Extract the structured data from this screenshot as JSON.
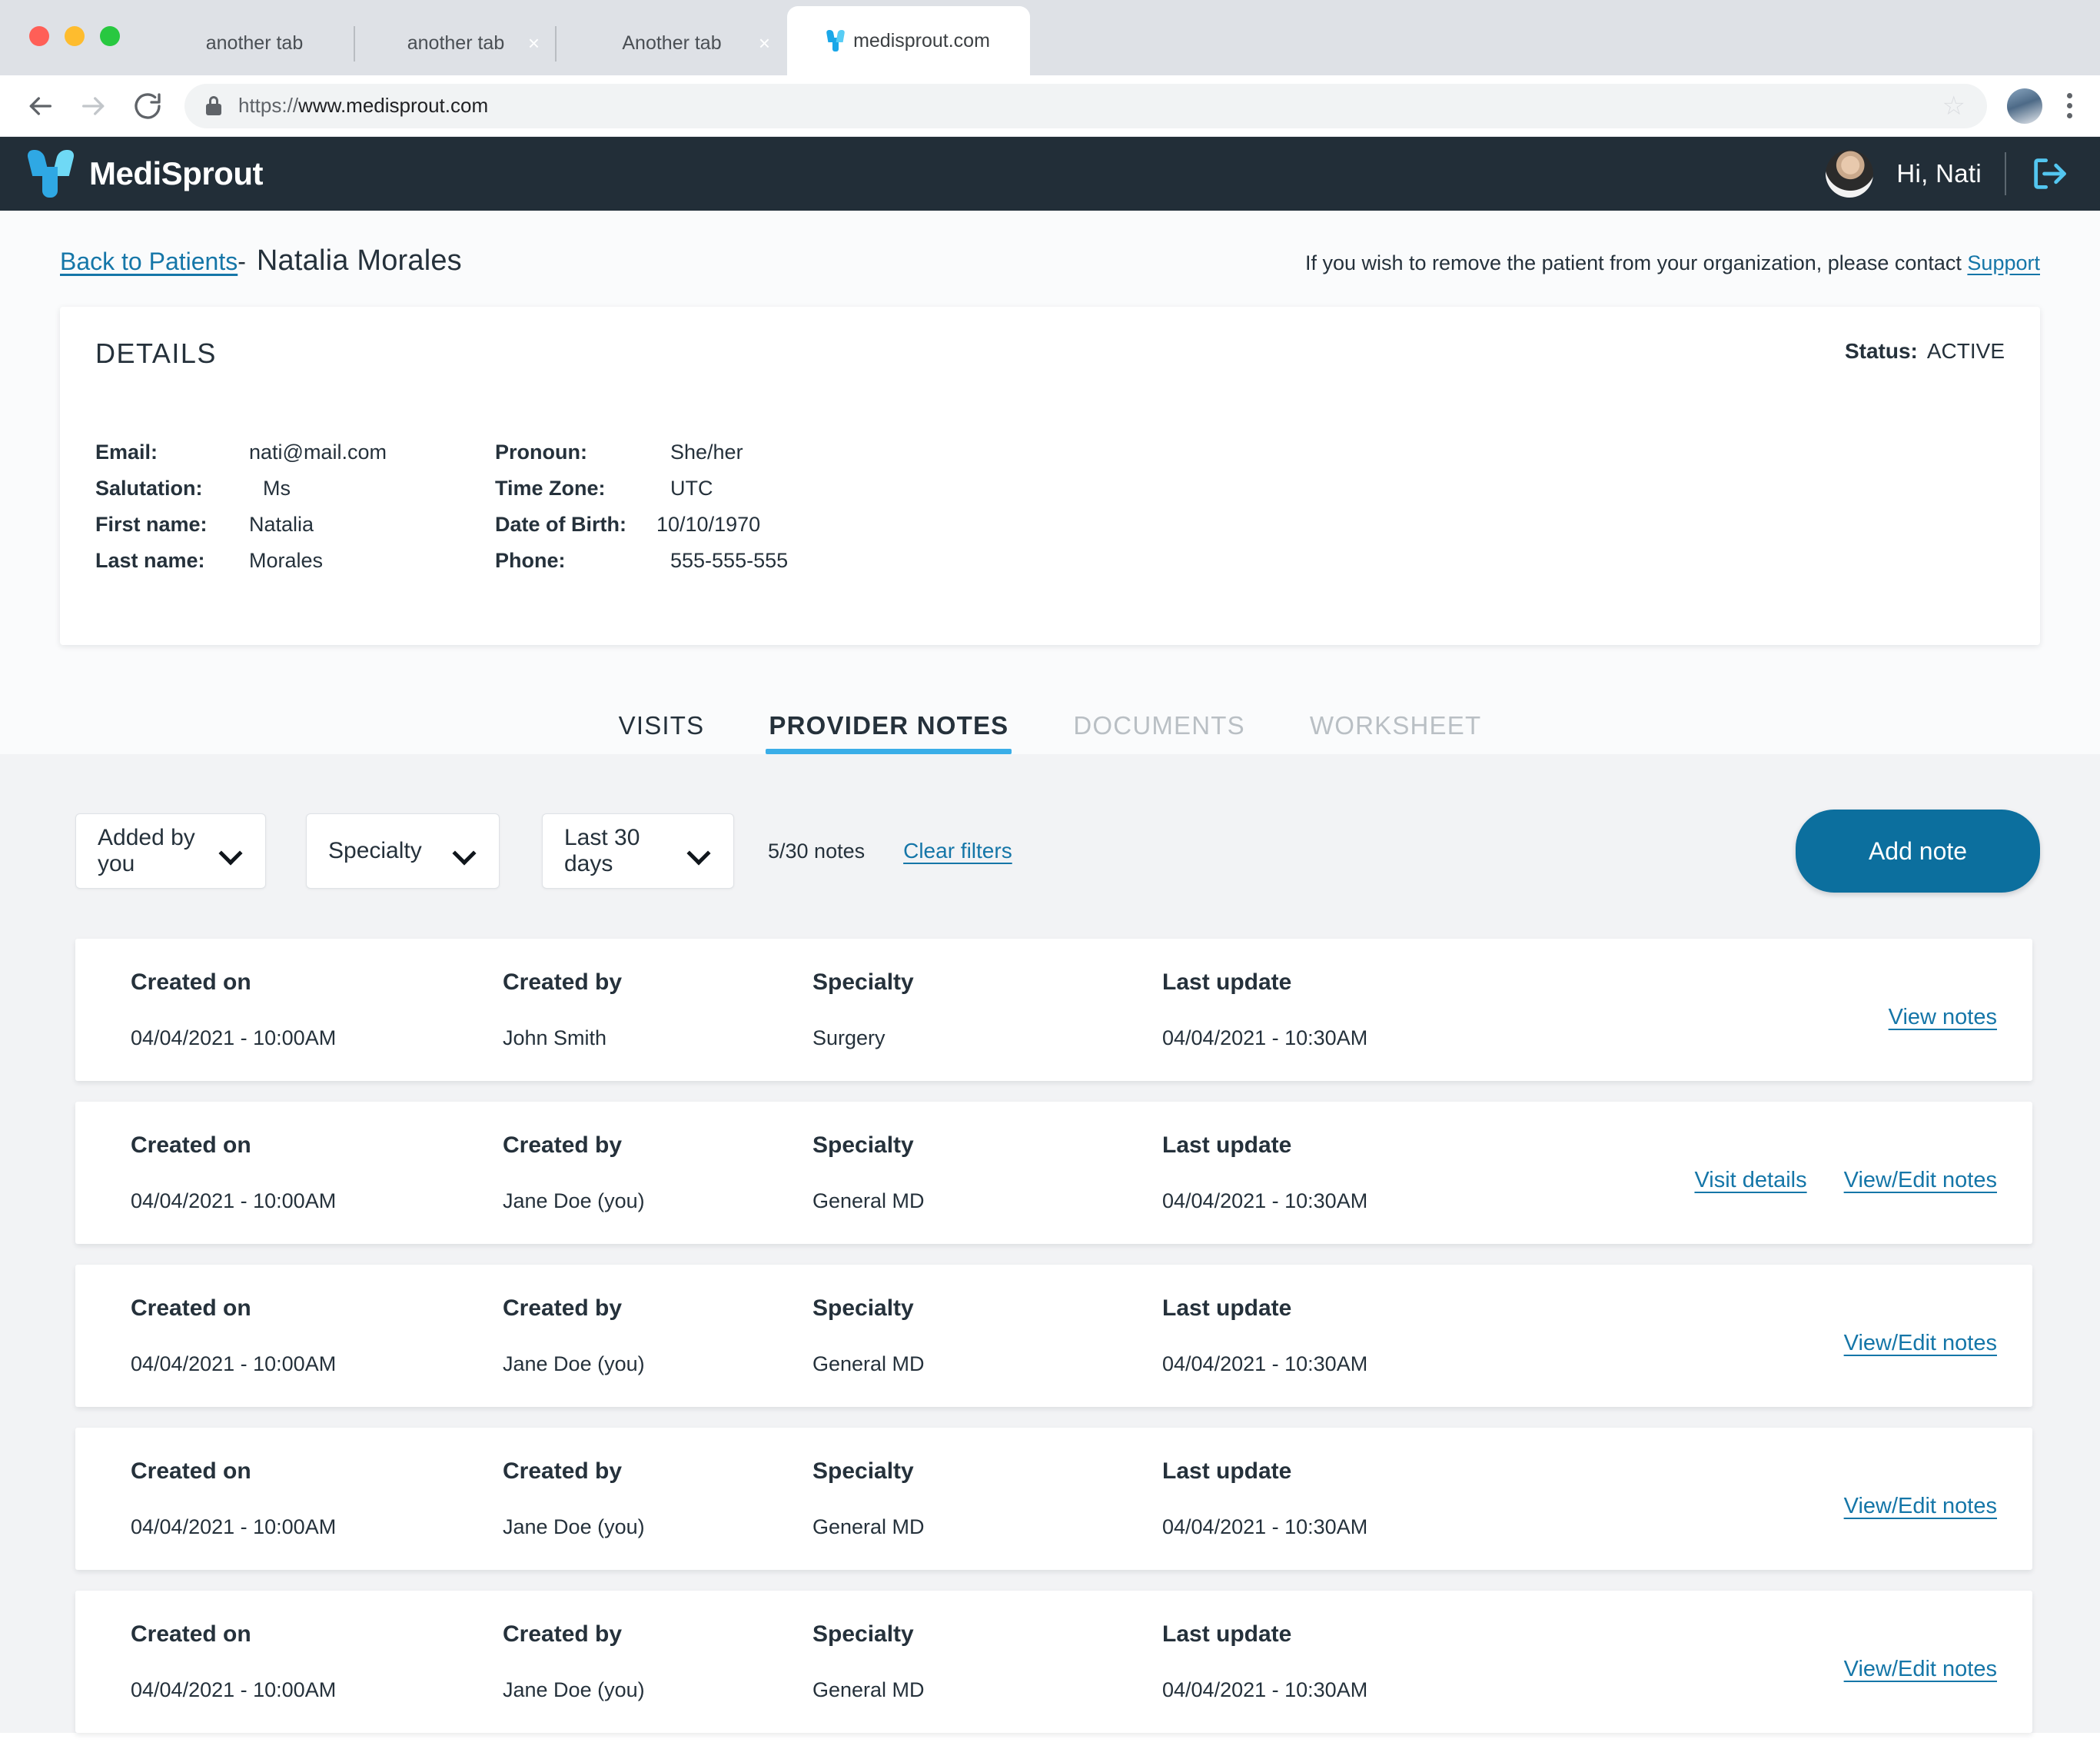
{
  "browser": {
    "tabs": [
      {
        "label": "another tab",
        "closable": false,
        "active": false
      },
      {
        "label": "another tab",
        "closable": true,
        "active": false
      },
      {
        "label": "Another tab",
        "closable": true,
        "active": false
      },
      {
        "label": "medisprout.com",
        "closable": false,
        "active": true
      }
    ],
    "close_glyph": "×",
    "url_scheme": "https://",
    "url_host": "www.medisprout.com",
    "star_glyph": "☆",
    "back_icon": "back-arrow-icon",
    "forward_icon": "forward-arrow-icon",
    "reload_icon": "reload-icon",
    "lock_icon": "lock-icon",
    "menu_icon": "kebab-menu-icon"
  },
  "app_header": {
    "brand": "MediSprout",
    "logo_icon": "medisprout-sprout-logo",
    "greeting": "Hi, Nati",
    "logout_icon": "logout-icon",
    "bg_color": "#222e38",
    "accent_color": "#3aaee8"
  },
  "breadcrumb": {
    "back_link": "Back to Patients",
    "dash": "-",
    "patient_name": "Natalia Morales"
  },
  "support_note": {
    "text": "If you wish to remove the patient from your organization, please contact ",
    "link": "Support"
  },
  "details": {
    "title": "DETAILS",
    "status_label": "Status:",
    "status_value": "ACTIVE",
    "left_fields": [
      {
        "label": "Email:",
        "value": "nati@mail.com"
      },
      {
        "label": "Salutation:",
        "value": "Ms"
      },
      {
        "label": "First name:",
        "value": "Natalia"
      },
      {
        "label": "Last name:",
        "value": "Morales"
      }
    ],
    "right_fields": [
      {
        "label": "Pronoun:",
        "value": "She/her"
      },
      {
        "label": "Time Zone:",
        "value": "UTC"
      },
      {
        "label": "Date of Birth:",
        "value": "10/10/1970"
      },
      {
        "label": "Phone:",
        "value": "555-555-555"
      }
    ]
  },
  "section_tabs": [
    {
      "label": "VISITS",
      "state": "dark"
    },
    {
      "label": "PROVIDER NOTES",
      "state": "active"
    },
    {
      "label": "DOCUMENTS",
      "state": "muted"
    },
    {
      "label": "WORKSHEET",
      "state": "muted"
    }
  ],
  "filters": {
    "added_by": "Added by you",
    "specialty": "Specialty",
    "date_range": "Last 30 days",
    "notes_count": "5/30 notes",
    "clear_filters": "Clear filters",
    "add_note": "Add note",
    "add_note_color": "#0c6f9e",
    "chevron_icon": "chevron-down-icon"
  },
  "notes_table": {
    "headers": {
      "created_on": "Created on",
      "created_by": "Created by",
      "specialty": "Specialty",
      "last_update": "Last update"
    },
    "rows": [
      {
        "created_on": "04/04/2021 - 10:00AM",
        "created_by": "John Smith",
        "specialty": "Surgery",
        "last_update": "04/04/2021 - 10:30AM",
        "actions": [
          {
            "label": "View notes",
            "name": "view-notes-link"
          }
        ]
      },
      {
        "created_on": "04/04/2021 - 10:00AM",
        "created_by": "Jane Doe (you)",
        "specialty": "General MD",
        "last_update": "04/04/2021 - 10:30AM",
        "actions": [
          {
            "label": "Visit details",
            "name": "visit-details-link"
          },
          {
            "label": "View/Edit notes",
            "name": "view-edit-notes-link"
          }
        ]
      },
      {
        "created_on": "04/04/2021 - 10:00AM",
        "created_by": "Jane Doe (you)",
        "specialty": "General MD",
        "last_update": "04/04/2021 - 10:30AM",
        "actions": [
          {
            "label": "View/Edit notes",
            "name": "view-edit-notes-link"
          }
        ]
      },
      {
        "created_on": "04/04/2021 - 10:00AM",
        "created_by": "Jane Doe (you)",
        "specialty": "General MD",
        "last_update": "04/04/2021 - 10:30AM",
        "actions": [
          {
            "label": "View/Edit notes",
            "name": "view-edit-notes-link"
          }
        ]
      },
      {
        "created_on": "04/04/2021 - 10:00AM",
        "created_by": "Jane Doe (you)",
        "specialty": "General MD",
        "last_update": "04/04/2021 - 10:30AM",
        "actions": [
          {
            "label": "View/Edit notes",
            "name": "view-edit-notes-link"
          }
        ]
      }
    ]
  }
}
